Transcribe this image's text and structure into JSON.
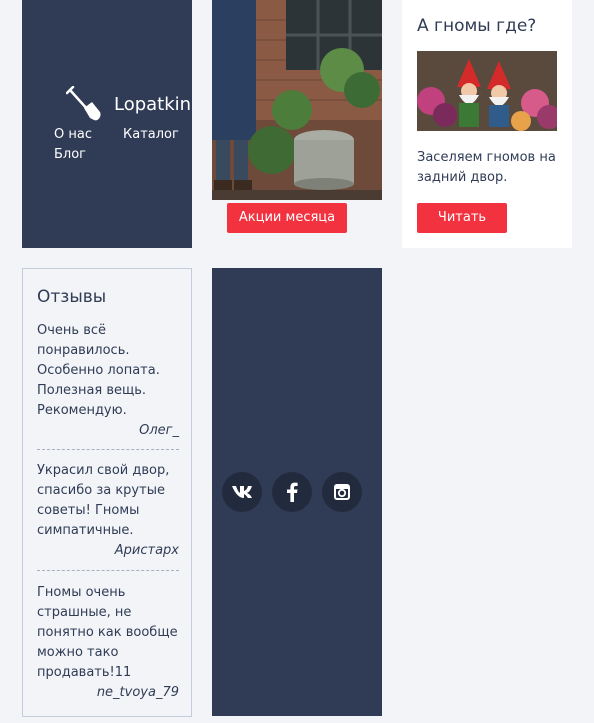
{
  "brand": {
    "name": "Lopatkin",
    "nav": {
      "about": "О нас",
      "catalog": "Каталог",
      "blog": "Блог"
    }
  },
  "promo": {
    "button_label": "Акции месяца"
  },
  "gnome_card": {
    "title": "А гномы где?",
    "text": "Заселяем гномов на задний двор.",
    "button_label": "Читать"
  },
  "reviews": {
    "title": "Отзывы",
    "items": [
      {
        "text": "Очень всё понравилось. Особенно лопата. Полезная вещь. Рекомендую.",
        "author": "Олег_"
      },
      {
        "text": "Украсил свой двор, спасибо за крутые советы! Гномы симпатичные.",
        "author": "Аристарх"
      },
      {
        "text": "Гномы очень страшные, не понятно как вообще можно тако продавать!11",
        "author": "ne_tvoya_79"
      }
    ]
  },
  "social": {
    "icons": [
      "vk-icon",
      "facebook-icon",
      "instagram-icon"
    ]
  },
  "colors": {
    "navy": "#303c56",
    "accent_red": "#f2323f",
    "page_bg": "#f2f4f7"
  }
}
